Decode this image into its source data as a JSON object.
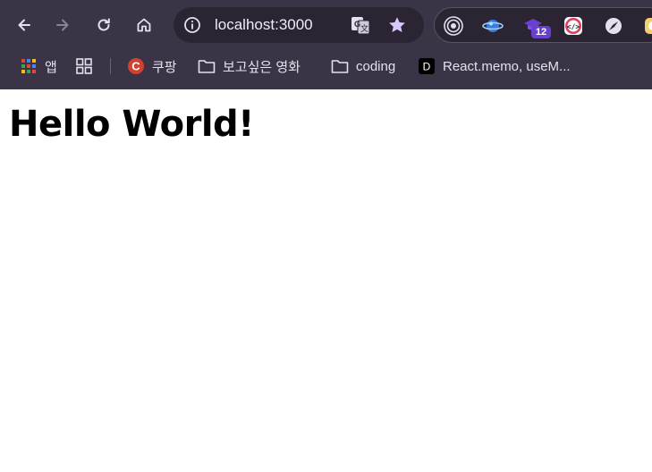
{
  "browser": {
    "address_bar": {
      "url": "localhost:3000"
    },
    "extensions": {
      "badge_count": "12"
    },
    "bookmarks": [
      {
        "label": "앱",
        "icon": "apps-grid-icon"
      },
      {
        "label": "",
        "icon": "tab-groups-icon"
      },
      {
        "label": "쿠팡",
        "icon": "coupang-favicon"
      },
      {
        "label": "보고싶은 영화",
        "icon": "folder-icon"
      },
      {
        "label": "coding",
        "icon": "folder-icon"
      },
      {
        "label": "React.memo, useM...",
        "icon": "dev-favicon"
      }
    ]
  },
  "page": {
    "heading": "Hello World!"
  },
  "colors": {
    "chrome_bg": "#3b3447",
    "omnibox_bg": "#2a2433",
    "star": "#d8c8ff",
    "badge": "#6a3fd0",
    "page_bg": "#ffffff"
  }
}
